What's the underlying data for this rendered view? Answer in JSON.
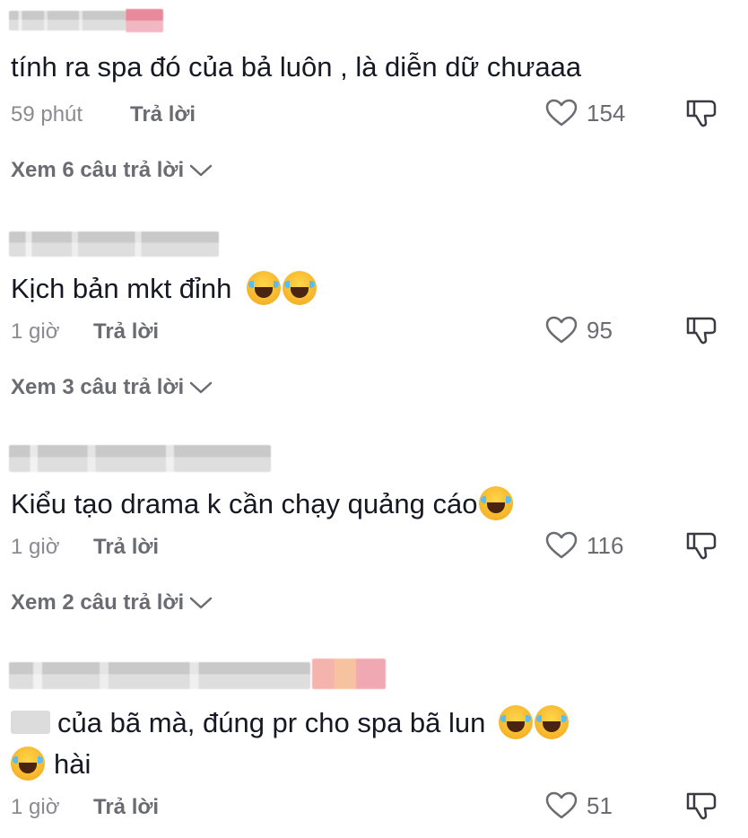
{
  "comments": [
    {
      "text": "tính ra spa đó của bả luôn , là diễn dữ chưaaa",
      "time": "59 phút",
      "reply_label": "Trả lời",
      "likes": "154",
      "view_replies": "Xem 6 câu trả lời"
    },
    {
      "text": "Kịch bản mkt đỉnh",
      "emoji_count": 2,
      "time": "1 giờ",
      "reply_label": "Trả lời",
      "likes": "95",
      "view_replies": "Xem 3 câu trả lời"
    },
    {
      "text": "Kiểu tạo drama k cần chạy quảng cáo",
      "emoji_count": 1,
      "time": "1 giờ",
      "reply_label": "Trả lời",
      "likes": "116",
      "view_replies": "Xem 2 câu trả lời"
    },
    {
      "text_line1": "của bã mà, đúng pr cho spa bã lun",
      "text_line2": "hài",
      "time": "1 giờ",
      "reply_label": "Trả lời",
      "likes": "51"
    }
  ],
  "icons": {
    "like": "heart-outline-icon",
    "dislike": "thumbs-down-outline-icon",
    "expand": "chevron-down-icon",
    "emoji": "face-with-tears-of-joy-emoji"
  },
  "colors": {
    "text": "#161823",
    "meta": "#8a8b91",
    "secondary": "#6b6c72",
    "background": "#ffffff"
  }
}
